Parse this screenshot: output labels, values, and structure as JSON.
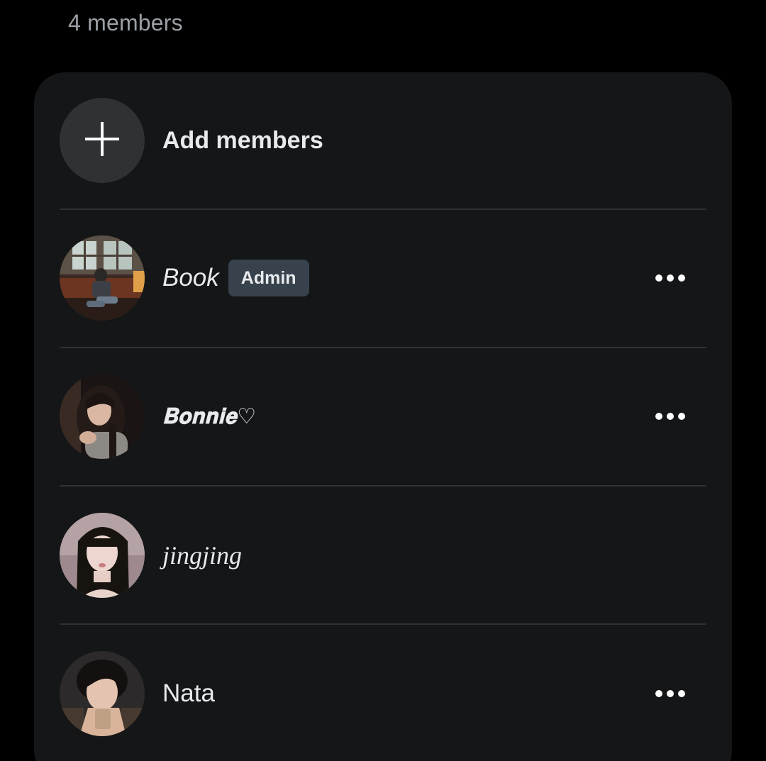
{
  "header": {
    "member_count": "4 members"
  },
  "add_members": {
    "label": "Add members",
    "icon": "plus-icon"
  },
  "members": [
    {
      "name": "Book",
      "badge": "Admin",
      "has_menu": true,
      "menu_icon": "more-horizontal-icon"
    },
    {
      "name": "𝐁𝐨𝐧𝐧𝐢𝐞♡",
      "has_menu": true,
      "menu_icon": "more-horizontal-icon"
    },
    {
      "name": "jingjing",
      "has_menu": false
    },
    {
      "name": "Nata",
      "has_menu": true,
      "menu_icon": "more-horizontal-icon"
    }
  ],
  "colors": {
    "background": "#000000",
    "card": "#141618",
    "divider": "#2f3235",
    "add_circle": "#2e3235",
    "badge_bg": "#37424c",
    "text": "#e8eaed",
    "muted_text": "#9aa0a6"
  }
}
